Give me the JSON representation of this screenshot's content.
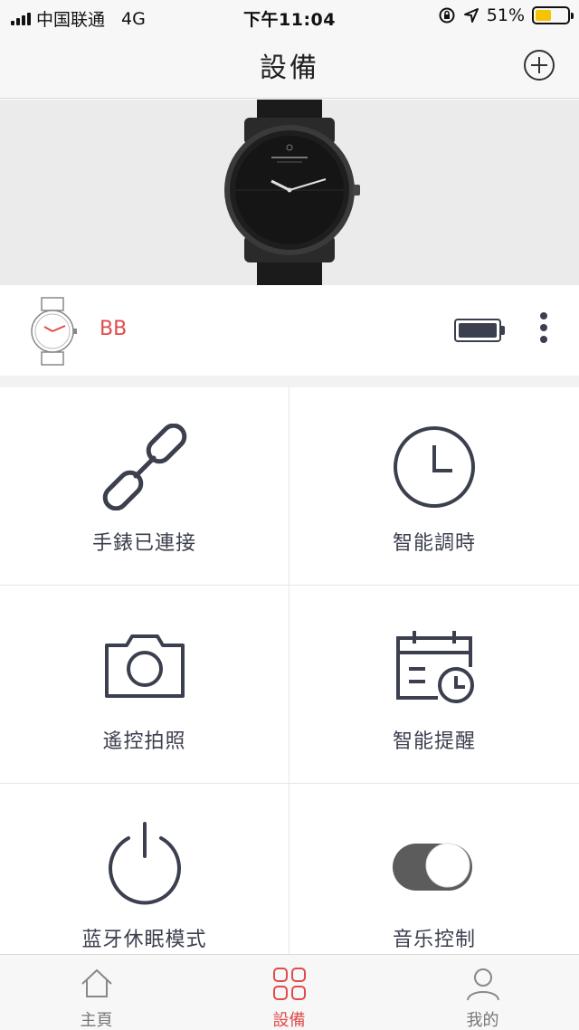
{
  "status_bar": {
    "carrier": "中国联通",
    "network": "4G",
    "time": "下午11:04",
    "battery_percent": "51%",
    "battery_level": 0.51,
    "battery_color": "#f5c400"
  },
  "header": {
    "title": "設備",
    "add_icon": "plus-circle-icon"
  },
  "device": {
    "name": "BB",
    "battery_level": 1.0,
    "name_color": "#e14b4b"
  },
  "features": [
    {
      "label": "手錶已連接",
      "icon": "link-icon"
    },
    {
      "label": "智能調時",
      "icon": "clock-icon"
    },
    {
      "label": "遙控拍照",
      "icon": "camera-icon"
    },
    {
      "label": "智能提醒",
      "icon": "calendar-clock-icon"
    },
    {
      "label": "蓝牙休眠模式",
      "icon": "power-icon"
    },
    {
      "label": "音乐控制",
      "icon": "toggle-icon"
    }
  ],
  "tabs": [
    {
      "label": "主頁",
      "icon": "home-icon",
      "active": false
    },
    {
      "label": "設備",
      "icon": "grid-icon",
      "active": true
    },
    {
      "label": "我的",
      "icon": "user-icon",
      "active": false
    }
  ],
  "colors": {
    "accent": "#e14b4b",
    "icon": "#3b3f4e"
  }
}
